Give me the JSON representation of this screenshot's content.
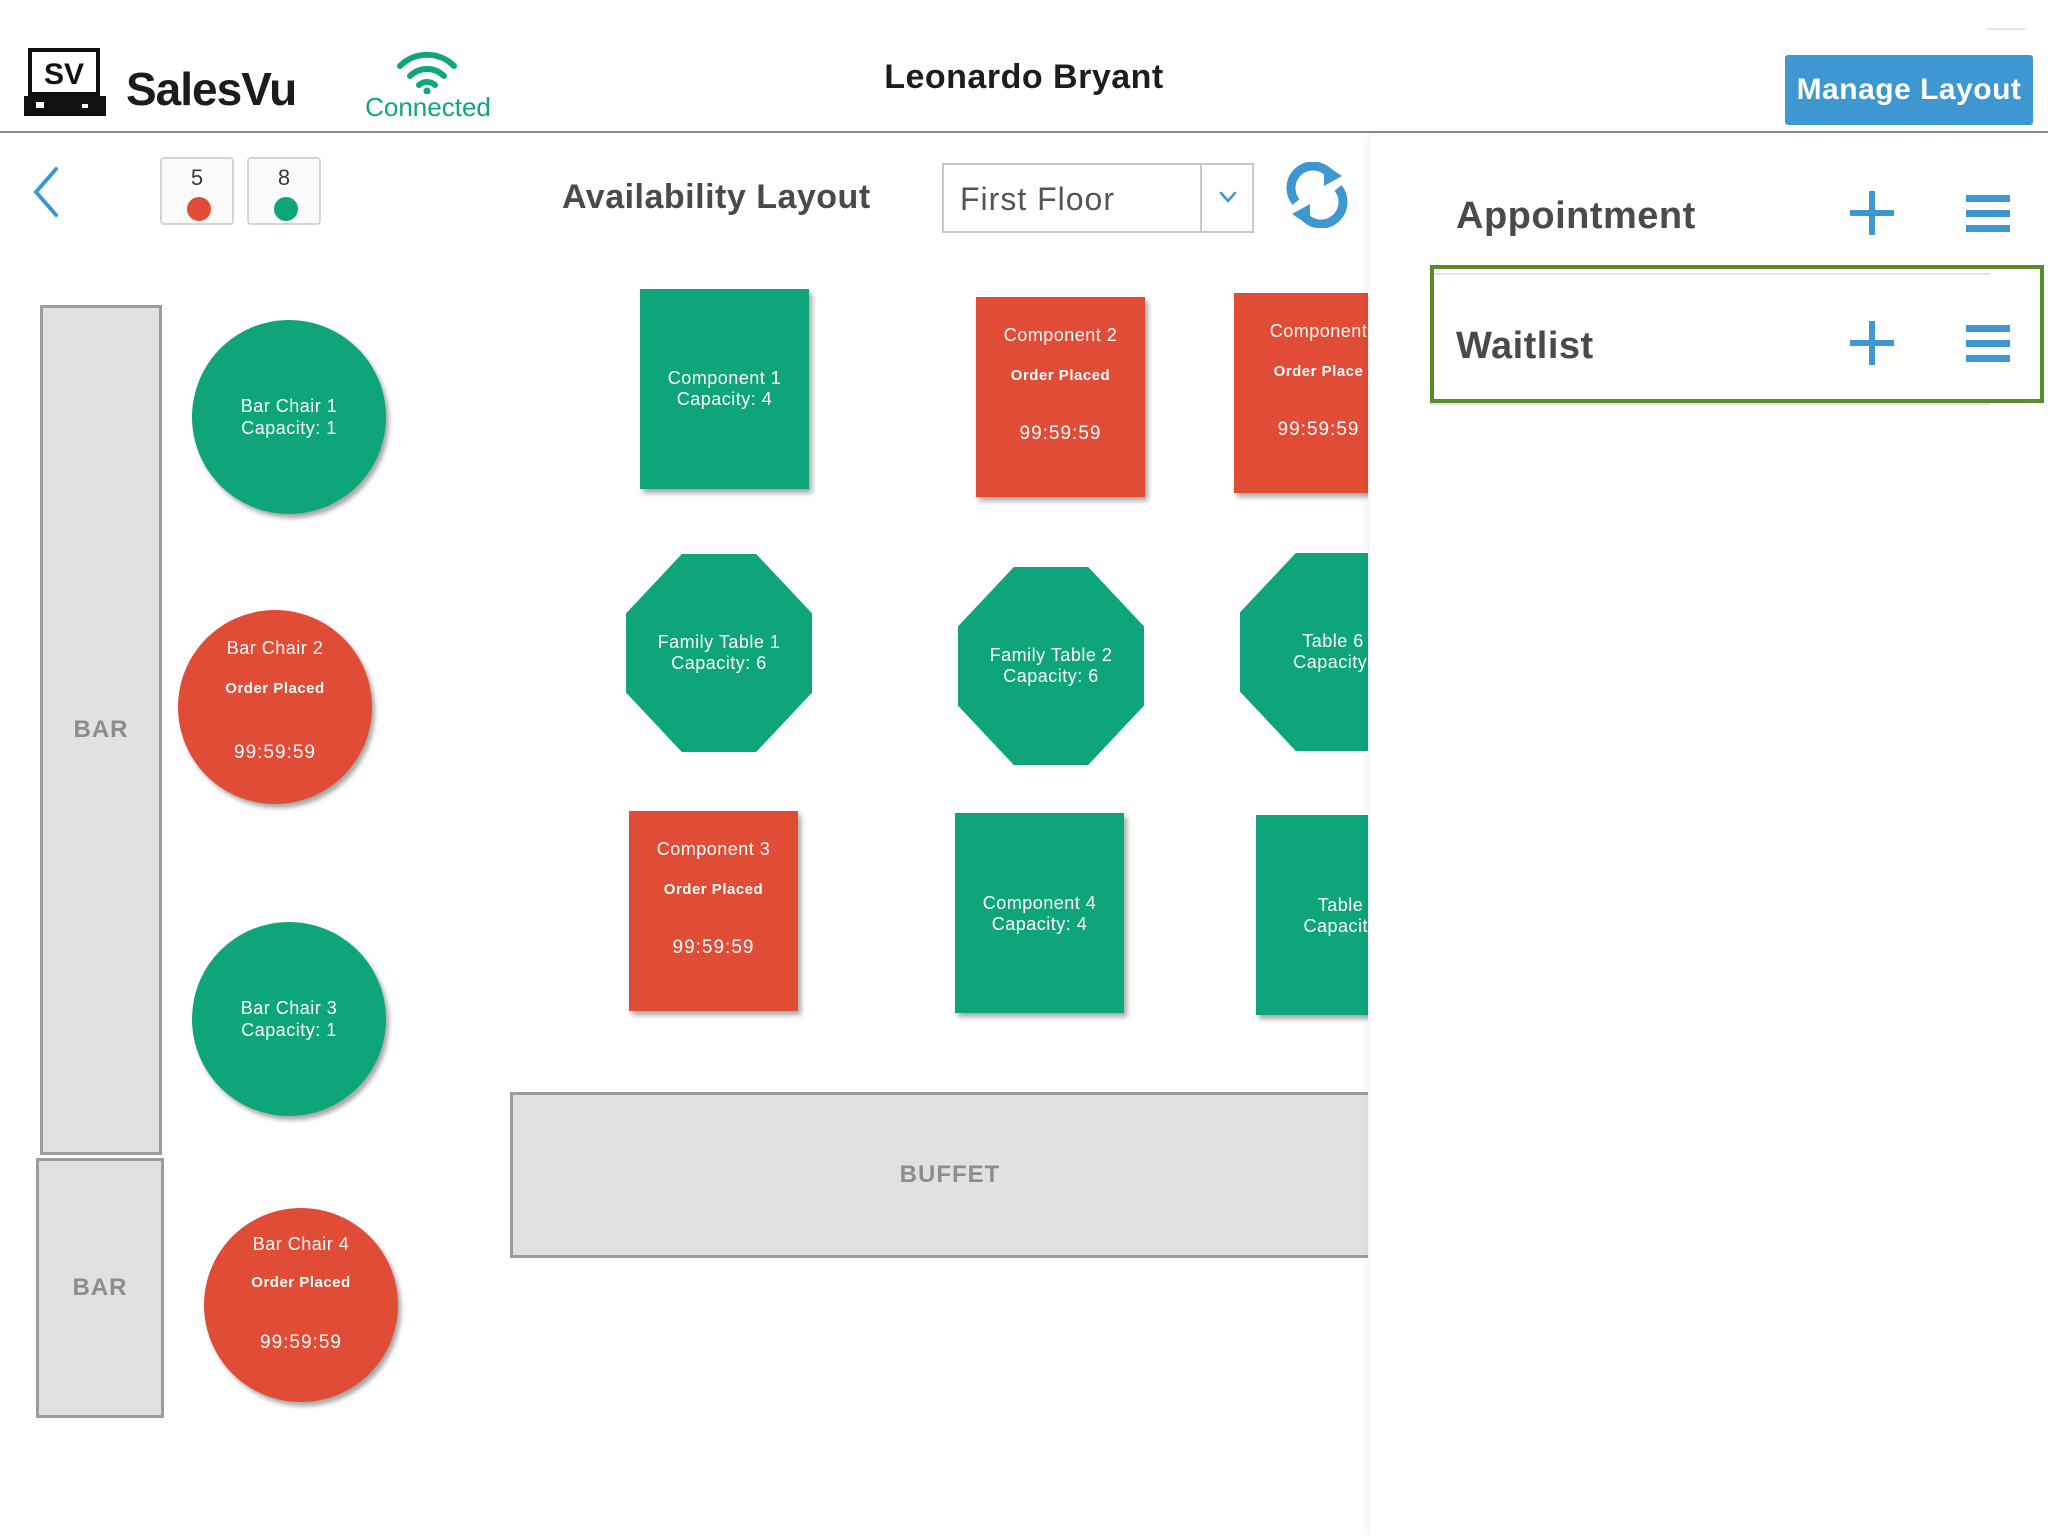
{
  "header": {
    "brand": "SalesVu",
    "logo_text": "SV",
    "connection_status": "Connected",
    "user_name": "Leonardo Bryant",
    "manage_layout_label": "Manage Layout"
  },
  "toolbar": {
    "occupied_count": "5",
    "available_count": "8",
    "layout_title": "Availability Layout",
    "floor_value": "First Floor"
  },
  "floor_plan": {
    "bar_1_label": "BAR",
    "bar_2_label": "BAR",
    "buffet_label": "BUFFET",
    "tables": [
      {
        "name": "Bar Chair 1",
        "capacity": "Capacity: 1",
        "state": "available"
      },
      {
        "name": "Bar Chair 2",
        "status": "Order Placed",
        "timer": "99:59:59",
        "state": "occupied"
      },
      {
        "name": "Bar Chair 3",
        "capacity": "Capacity: 1",
        "state": "available"
      },
      {
        "name": "Bar Chair 4",
        "status": "Order Placed",
        "timer": "99:59:59",
        "state": "occupied"
      },
      {
        "name": "Component 1",
        "capacity": "Capacity: 4",
        "state": "available"
      },
      {
        "name": "Component 2",
        "status": "Order Placed",
        "timer": "99:59:59",
        "state": "occupied"
      },
      {
        "name": "Component",
        "status": "Order Place",
        "timer": "99:59:59",
        "state": "occupied"
      },
      {
        "name": "Family Table 1",
        "capacity": "Capacity: 6",
        "state": "available"
      },
      {
        "name": "Family Table 2",
        "capacity": "Capacity: 6",
        "state": "available"
      },
      {
        "name": "Table 6",
        "capacity": "Capacity:",
        "state": "available"
      },
      {
        "name": "Component 3",
        "status": "Order Placed",
        "timer": "99:59:59",
        "state": "occupied"
      },
      {
        "name": "Component 4",
        "capacity": "Capacity: 4",
        "state": "available"
      },
      {
        "name": "Table",
        "capacity": "Capacity",
        "state": "available"
      }
    ]
  },
  "side_panel": {
    "appointment_label": "Appointment",
    "waitlist_label": "Waitlist"
  },
  "colors": {
    "available": "#0fa57a",
    "occupied": "#e14c37",
    "accent": "#3e97d1",
    "highlight": "#5a8a2e"
  },
  "icons": {
    "logo": "salesvu-register-logo",
    "connection": "wifi-icon",
    "back": "chevron-left-icon",
    "dropdown": "chevron-down-icon",
    "refresh": "refresh-icon",
    "add": "plus-icon",
    "menu": "hamburger-menu-icon",
    "panel_toggle": "chevron-right-icon"
  }
}
